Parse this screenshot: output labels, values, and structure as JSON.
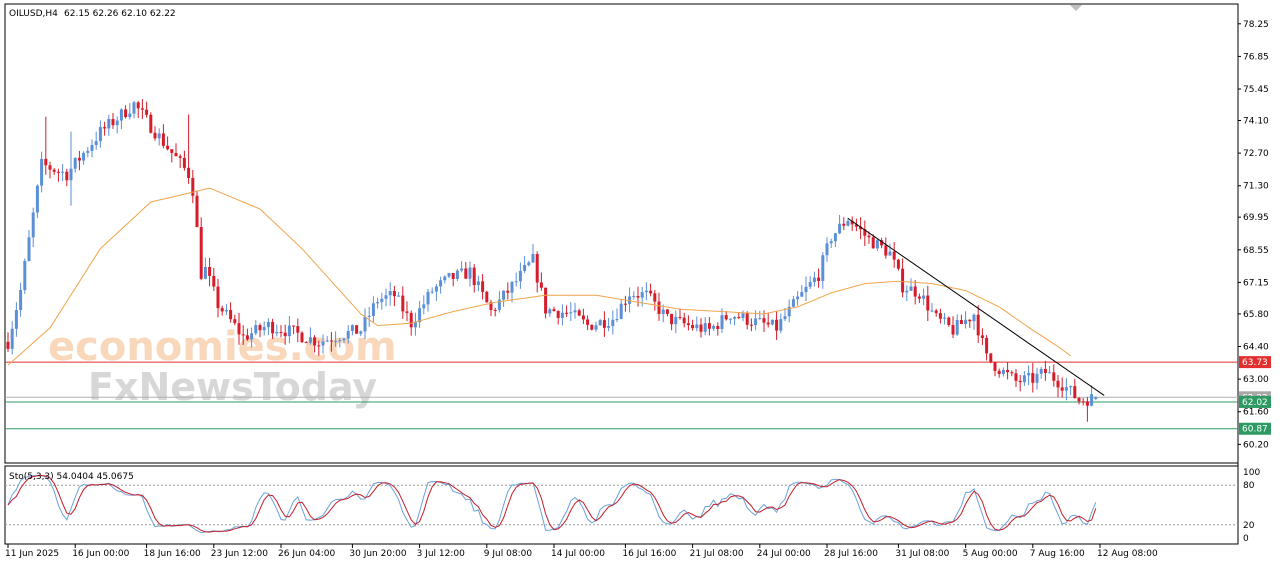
{
  "header": {
    "symbol": "OILUSD,H4",
    "ohlc": "62.15 62.26 62.10 62.22"
  },
  "watermark": {
    "line1": "economies.com",
    "line2": "FxNewsToday"
  },
  "colors": {
    "bull": "#5b8fd6",
    "bear": "#d61c2a",
    "ma": "#f0a44a",
    "support": "#e23030",
    "level": "#2e9a63",
    "trendline": "#000000",
    "stoch_main": "#6aa2da",
    "stoch_signal": "#c41e2a"
  },
  "chart_data": [
    {
      "type": "candlestick",
      "name": "price",
      "timeframe": "H4",
      "x_labels": [
        "11 Jun 2025",
        "16 Jun 00:00",
        "18 Jun 16:00",
        "23 Jun 12:00",
        "26 Jun 04:00",
        "30 Jun 20:00",
        "3 Jul 12:00",
        "9 Jul 08:00",
        "14 Jul 00:00",
        "16 Jul 16:00",
        "21 Jul 08:00",
        "24 Jul 00:00",
        "28 Jul 16:00",
        "31 Jul 08:00",
        "5 Aug 00:00",
        "7 Aug 16:00",
        "12 Aug 08:00"
      ],
      "y_ticks": [
        "78.25",
        "76.85",
        "75.45",
        "74.10",
        "72.70",
        "71.30",
        "69.95",
        "68.55",
        "67.15",
        "65.80",
        "64.40",
        "63.00",
        "61.60",
        "60.20"
      ],
      "ylim": [
        59.4,
        79.1
      ],
      "path_anchors": [
        [
          0,
          64.6
        ],
        [
          3,
          66.8
        ],
        [
          8,
          72.2
        ],
        [
          14,
          71.8
        ],
        [
          22,
          73.6
        ],
        [
          30,
          74.8
        ],
        [
          36,
          73.4
        ],
        [
          43,
          71.8
        ],
        [
          46,
          68.2
        ],
        [
          50,
          66.2
        ],
        [
          56,
          64.8
        ],
        [
          62,
          65.3
        ],
        [
          68,
          65.0
        ],
        [
          74,
          64.6
        ],
        [
          79,
          64.9
        ],
        [
          84,
          65.1
        ],
        [
          88,
          66.4
        ],
        [
          92,
          66.6
        ],
        [
          96,
          65.4
        ],
        [
          101,
          66.8
        ],
        [
          105,
          67.3
        ],
        [
          110,
          67.6
        ],
        [
          115,
          65.9
        ],
        [
          121,
          67.2
        ],
        [
          125,
          68.1
        ],
        [
          128,
          66.0
        ],
        [
          134,
          65.8
        ],
        [
          138,
          65.3
        ],
        [
          144,
          65.6
        ],
        [
          148,
          66.7
        ],
        [
          152,
          66.6
        ],
        [
          157,
          65.6
        ],
        [
          162,
          65.3
        ],
        [
          167,
          65.1
        ],
        [
          172,
          65.8
        ],
        [
          177,
          65.5
        ],
        [
          183,
          65.2
        ],
        [
          188,
          66.4
        ],
        [
          193,
          67.5
        ],
        [
          196,
          69.1
        ],
        [
          200,
          69.9
        ],
        [
          205,
          69.0
        ],
        [
          210,
          68.4
        ],
        [
          213,
          67.0
        ],
        [
          217,
          66.7
        ],
        [
          221,
          65.6
        ],
        [
          225,
          65.1
        ],
        [
          230,
          65.8
        ],
        [
          233,
          63.9
        ],
        [
          237,
          63.3
        ],
        [
          240,
          62.9
        ],
        [
          244,
          63.0
        ],
        [
          247,
          63.3
        ],
        [
          251,
          62.8
        ],
        [
          255,
          62.1
        ],
        [
          259,
          62.2
        ]
      ],
      "last_bar": {
        "open": 62.15,
        "high": 62.26,
        "low": 62.1,
        "close": 62.22
      },
      "moving_average": [
        [
          0,
          63.6
        ],
        [
          10,
          65.2
        ],
        [
          22,
          68.6
        ],
        [
          34,
          70.6
        ],
        [
          48,
          71.2
        ],
        [
          60,
          70.3
        ],
        [
          70,
          68.6
        ],
        [
          78,
          67.0
        ],
        [
          84,
          65.8
        ],
        [
          88,
          65.3
        ],
        [
          96,
          65.4
        ],
        [
          106,
          65.9
        ],
        [
          116,
          66.3
        ],
        [
          128,
          66.6
        ],
        [
          140,
          66.6
        ],
        [
          150,
          66.3
        ],
        [
          160,
          66.0
        ],
        [
          170,
          65.9
        ],
        [
          180,
          65.8
        ],
        [
          188,
          66.1
        ],
        [
          196,
          66.7
        ],
        [
          204,
          67.1
        ],
        [
          212,
          67.2
        ],
        [
          220,
          67.1
        ],
        [
          228,
          66.8
        ],
        [
          236,
          66.1
        ],
        [
          244,
          65.1
        ],
        [
          250,
          64.4
        ],
        [
          253,
          64.0
        ]
      ],
      "trendline": [
        [
          200,
          69.9
        ],
        [
          261,
          62.3
        ]
      ],
      "price_labels": [
        {
          "value": 63.73,
          "text": "63.73",
          "role": "support"
        },
        {
          "value": 62.22,
          "text": "62.22",
          "role": "current"
        },
        {
          "value": 62.02,
          "text": "62.02",
          "role": "level"
        },
        {
          "value": 60.87,
          "text": "60.87",
          "role": "level"
        }
      ],
      "horizontal_lines": [
        {
          "value": 63.73,
          "role": "support"
        },
        {
          "value": 62.02,
          "role": "level"
        },
        {
          "value": 60.87,
          "role": "level"
        },
        {
          "value": 62.22,
          "role": "current"
        }
      ]
    },
    {
      "type": "line",
      "name": "stochastic",
      "label": "Sto(5,3,3) 54.0404 45.0675",
      "y_ticks": [
        "100",
        "80",
        "20",
        "0"
      ],
      "ylim": [
        0,
        100
      ],
      "levels": [
        80,
        20
      ],
      "main_value": 54.0404,
      "signal_value": 45.0675
    }
  ]
}
